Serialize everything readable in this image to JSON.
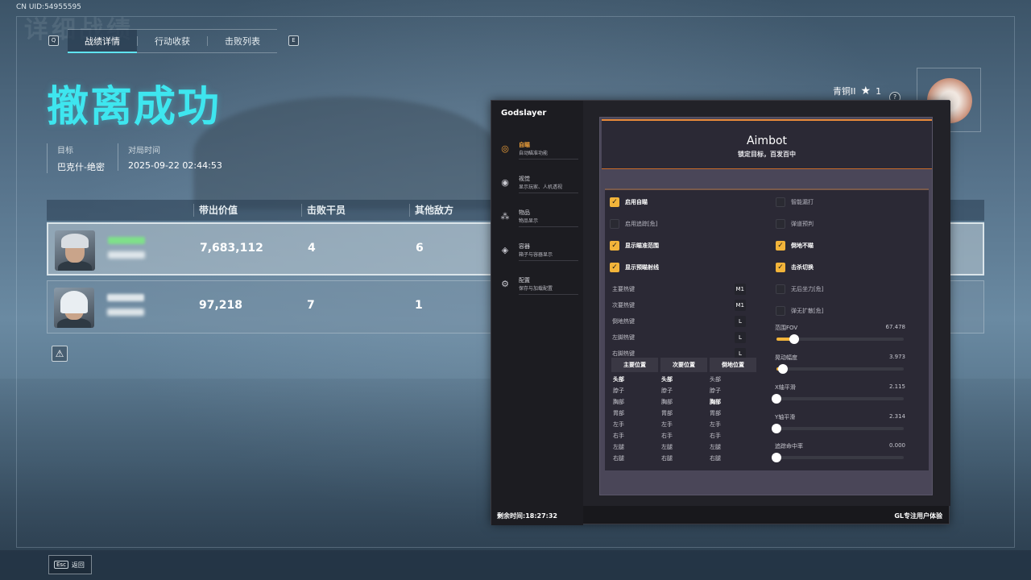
{
  "uid_text": "CN UID:54955595",
  "ghost_title": "详细战绩",
  "tabs": {
    "q_key": "Q",
    "e_key": "E",
    "items": [
      {
        "label": "战绩详情",
        "active": true
      },
      {
        "label": "行动收获",
        "active": false
      },
      {
        "label": "击败列表",
        "active": false
      }
    ]
  },
  "result_title": "撤离成功",
  "meta": {
    "target_label": "目标",
    "target_value": "巴克什-绝密",
    "time_label": "对局时间",
    "time_value": "2025-09-22 02:44:53"
  },
  "table": {
    "headers": [
      "带出价值",
      "击败干员",
      "其他敌方"
    ],
    "rows": [
      {
        "value": "7,683,112",
        "kills": "4",
        "others": "6"
      },
      {
        "value": "97,218",
        "kills": "7",
        "others": "1"
      }
    ]
  },
  "warning_icon_glyph": "⚠",
  "rank": {
    "name": "青铜II",
    "star": "★",
    "count": "1",
    "help": "?"
  },
  "esc": {
    "key": "Esc",
    "label": "返回"
  },
  "panel": {
    "brand": "Godslayer",
    "nav": [
      {
        "title": "自瞄",
        "desc": "自动瞄准功能",
        "icon": "◎",
        "active": true
      },
      {
        "title": "视觉",
        "desc": "显示玩家、人机透视",
        "icon": "◉",
        "active": false
      },
      {
        "title": "物品",
        "desc": "物品显示",
        "icon": "⁂",
        "active": false
      },
      {
        "title": "容器",
        "desc": "箱子与容器显示",
        "icon": "◈",
        "active": false
      },
      {
        "title": "配置",
        "desc": "保存与加载配置",
        "icon": "⚙",
        "active": false
      }
    ],
    "timer": "剩余时间:18:27:32",
    "footer_note": "GL专注用户体验",
    "hero_title": "Aimbot",
    "hero_subtitle": "锁定目标，百发百中",
    "check_glyph": "✓",
    "options_left": [
      {
        "label": "启用自瞄",
        "checked": true
      },
      {
        "label": "启用追踪[危]",
        "checked": false
      },
      {
        "label": "显示瞄准范围",
        "checked": true
      },
      {
        "label": "显示预瞄射线",
        "checked": true
      }
    ],
    "options_right": [
      {
        "label": "智能漏打",
        "checked": false
      },
      {
        "label": "弹道预判",
        "checked": false
      },
      {
        "label": "倒地不瞄",
        "checked": true
      },
      {
        "label": "击杀切换",
        "checked": true
      },
      {
        "label": "无后坐力[危]",
        "checked": false
      },
      {
        "label": "弹无扩散[危]",
        "checked": false
      }
    ],
    "hotkeys": [
      {
        "label": "主要热键",
        "key": "M1"
      },
      {
        "label": "次要热键",
        "key": "M1"
      },
      {
        "label": "倒地热键",
        "key": "L"
      },
      {
        "label": "左脚热键",
        "key": "L"
      },
      {
        "label": "右脚热键",
        "key": "L"
      }
    ],
    "bone_headers": [
      "主要位置",
      "次要位置",
      "倒地位置"
    ],
    "bone_rows": [
      "头部",
      "脖子",
      "胸部",
      "胃部",
      "左手",
      "右手",
      "左腿",
      "右腿"
    ],
    "bone_selected": [
      "头部",
      "头部",
      "胸部"
    ],
    "sliders": [
      {
        "label": "范围FOV",
        "value": "67.478",
        "fraction": 0.14
      },
      {
        "label": "晃动幅度",
        "value": "3.973",
        "fraction": 0.05
      },
      {
        "label": "X轴平滑",
        "value": "2.115",
        "fraction": 0.0
      },
      {
        "label": "Y轴平滑",
        "value": "2.314",
        "fraction": 0.0
      },
      {
        "label": "追踪命中率",
        "value": "0.000",
        "fraction": 0.0
      }
    ]
  },
  "colors": {
    "accent_cyan": "#3ee6ef",
    "accent_orange": "#f2b43a",
    "panel_bg": "#18181c",
    "blurred_name": "#7fe08a"
  }
}
